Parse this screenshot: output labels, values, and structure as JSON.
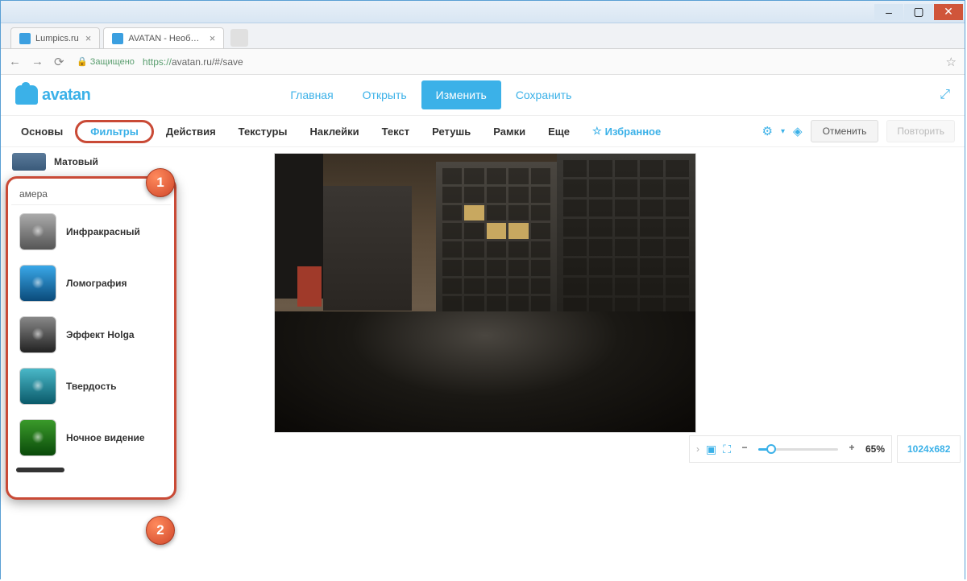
{
  "window": {
    "min": "–",
    "max": "▢",
    "close": "✕"
  },
  "browser": {
    "tabs": [
      {
        "title": "Lumpics.ru"
      },
      {
        "title": "AVATAN - Необычный"
      }
    ],
    "nav": {
      "back": "←",
      "fwd": "→",
      "reload": "⟳"
    },
    "secure_label": "Защищено",
    "url_prefix": "https://",
    "url_rest": "avatan.ru/#/save",
    "star": "☆"
  },
  "logo": "avatan",
  "top_nav": {
    "home": "Главная",
    "open": "Открыть",
    "edit": "Изменить",
    "save": "Сохранить"
  },
  "expand": "⤢",
  "tool_tabs": {
    "basic": "Основы",
    "filters": "Фильтры",
    "actions": "Действия",
    "textures": "Текстуры",
    "stickers": "Наклейки",
    "text": "Текст",
    "retouch": "Ретушь",
    "frames": "Рамки",
    "more": "Еще",
    "favorites": "Избранное",
    "fav_star": "☆"
  },
  "gear": "⚙",
  "layers": "◈",
  "undo": "Отменить",
  "redo": "Повторить",
  "callouts": {
    "one": "1",
    "two": "2"
  },
  "sidebar": {
    "top_item": "Матовый",
    "category": "амера",
    "cat_arrow": "▾",
    "items": [
      {
        "label": "Инфракрасный",
        "tone": "grey"
      },
      {
        "label": "Ломография",
        "tone": "blue"
      },
      {
        "label": "Эффект Holga",
        "tone": "dark"
      },
      {
        "label": "Твердость",
        "tone": "teal"
      },
      {
        "label": "Ночное видение",
        "tone": "green"
      }
    ]
  },
  "zoom": {
    "chev": "›",
    "fit": "▣",
    "full": "⛶",
    "minus": "−",
    "plus": "+",
    "pct": "65%"
  },
  "dims": "1024x682"
}
